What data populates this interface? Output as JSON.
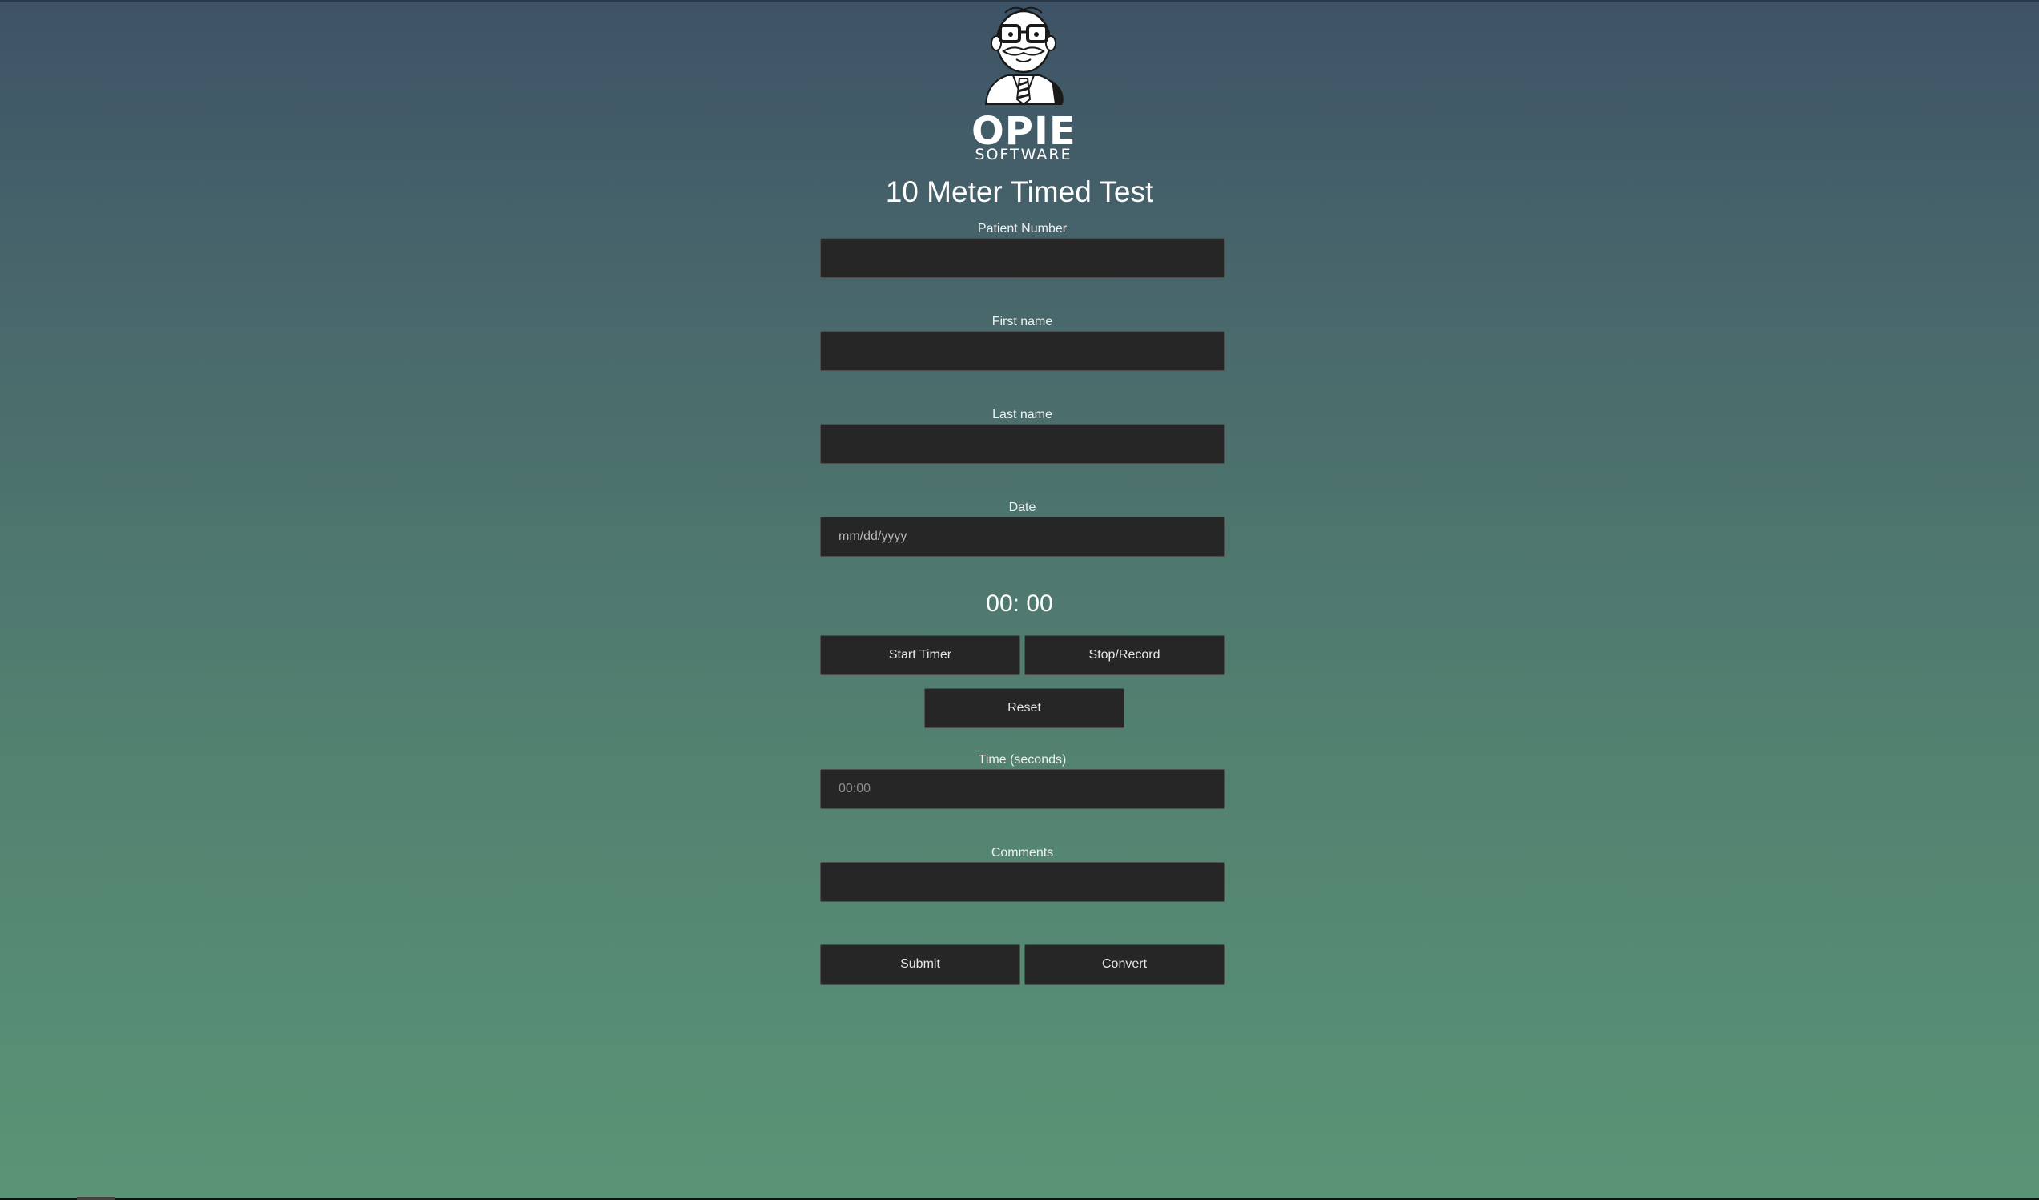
{
  "brand": {
    "logo_name": "OPIE",
    "logo_sub": "SOFTWARE",
    "mascot_icon": "opie-mascot-icon"
  },
  "page": {
    "title": "10 Meter Timed Test"
  },
  "form": {
    "patient_number": {
      "label": "Patient Number",
      "value": "",
      "placeholder": ""
    },
    "first_name": {
      "label": "First name",
      "value": "",
      "placeholder": ""
    },
    "last_name": {
      "label": "Last name",
      "value": "",
      "placeholder": ""
    },
    "date": {
      "label": "Date",
      "value": "",
      "placeholder": "mm/dd/yyyy"
    },
    "time_seconds": {
      "label": "Time (seconds)",
      "value": "",
      "placeholder": "00:00"
    },
    "comments": {
      "label": "Comments",
      "value": "",
      "placeholder": ""
    }
  },
  "timer": {
    "display": "00: 00"
  },
  "buttons": {
    "start_timer": "Start Timer",
    "stop_record": "Stop/Record",
    "reset": "Reset",
    "submit": "Submit",
    "convert": "Convert"
  },
  "colors": {
    "background_top": "#3e5366",
    "background_bottom": "#5a9476",
    "field_bg": "#262626",
    "field_border": "#4d4d4d",
    "text": "#ffffff"
  }
}
